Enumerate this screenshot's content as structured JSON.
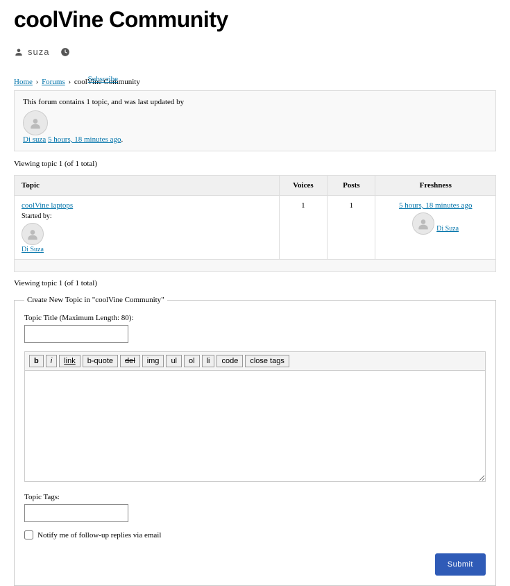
{
  "page": {
    "title": "coolVine Community",
    "author": "suza"
  },
  "subscribe_label": "Subscribe",
  "breadcrumb": {
    "home": "Home",
    "forums": "Forums",
    "current": "coolVine Community"
  },
  "forum_info": {
    "text": "This forum contains 1 topic, and was last updated by",
    "author": "Di suza",
    "time": "5 hours, 18 minutes ago"
  },
  "viewing_text": "Viewing topic 1 (of 1 total)",
  "table": {
    "headers": {
      "topic": "Topic",
      "voices": "Voices",
      "posts": "Posts",
      "freshness": "Freshness"
    },
    "row": {
      "topic_title": "coolVine laptops",
      "started_by_label": "Started by:",
      "started_by_author": "Di Suza",
      "voices": "1",
      "posts": "1",
      "fresh_time": "5 hours, 18 minutes ago",
      "fresh_author": "Di Suza"
    }
  },
  "form": {
    "legend": "Create New Topic in \"coolVine Community\"",
    "title_label": "Topic Title (Maximum Length: 80):",
    "toolbar": {
      "bold": "b",
      "italic": "i",
      "link": "link",
      "bquote": "b-quote",
      "del": "del",
      "img": "img",
      "ul": "ul",
      "ol": "ol",
      "li": "li",
      "code": "code",
      "close": "close tags"
    },
    "tags_label": "Topic Tags:",
    "notify_label": "Notify me of follow-up replies via email",
    "submit_label": "Submit"
  }
}
